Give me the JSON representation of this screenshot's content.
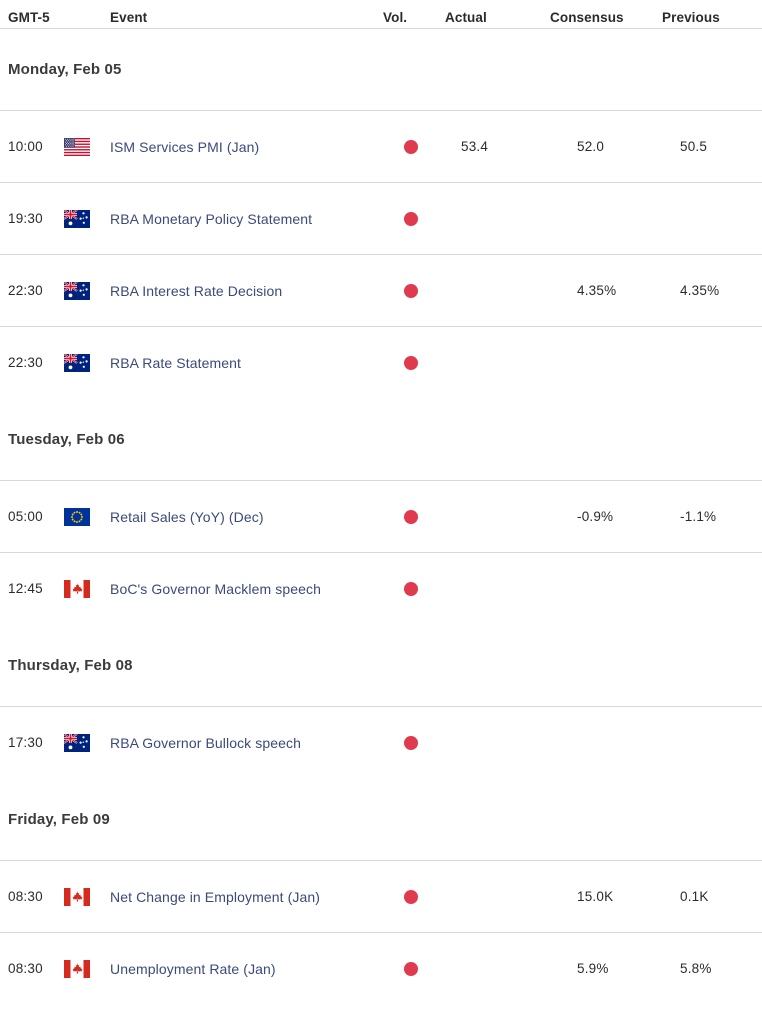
{
  "columns": {
    "time": "GMT-5",
    "event": "Event",
    "vol": "Vol.",
    "actual": "Actual",
    "consensus": "Consensus",
    "previous": "Previous"
  },
  "colors": {
    "volatility_dot": "#e03a4e",
    "event_link": "#3b4a7a",
    "divider": "#d6d9dc",
    "text": "#2b2b2b"
  },
  "groups": [
    {
      "date": "Monday, Feb 05",
      "rows": [
        {
          "time": "10:00",
          "flag": "us-flag-icon",
          "event": "ISM Services PMI (Jan)",
          "vol": "high-volatility-dot",
          "actual": "53.4",
          "consensus": "52.0",
          "previous": "50.5"
        },
        {
          "time": "19:30",
          "flag": "au-flag-icon",
          "event": "RBA Monetary Policy Statement",
          "vol": "high-volatility-dot",
          "actual": "",
          "consensus": "",
          "previous": ""
        },
        {
          "time": "22:30",
          "flag": "au-flag-icon",
          "event": "RBA Interest Rate Decision",
          "vol": "high-volatility-dot",
          "actual": "",
          "consensus": "4.35%",
          "previous": "4.35%"
        },
        {
          "time": "22:30",
          "flag": "au-flag-icon",
          "event": "RBA Rate Statement",
          "vol": "high-volatility-dot",
          "actual": "",
          "consensus": "",
          "previous": ""
        }
      ]
    },
    {
      "date": "Tuesday, Feb 06",
      "rows": [
        {
          "time": "05:00",
          "flag": "eu-flag-icon",
          "event": "Retail Sales (YoY) (Dec)",
          "vol": "high-volatility-dot",
          "actual": "",
          "consensus": "-0.9%",
          "previous": "-1.1%"
        },
        {
          "time": "12:45",
          "flag": "ca-flag-icon",
          "event": "BoC's Governor Macklem speech",
          "vol": "high-volatility-dot",
          "actual": "",
          "consensus": "",
          "previous": ""
        }
      ]
    },
    {
      "date": "Thursday, Feb 08",
      "rows": [
        {
          "time": "17:30",
          "flag": "au-flag-icon",
          "event": "RBA Governor Bullock speech",
          "vol": "high-volatility-dot",
          "actual": "",
          "consensus": "",
          "previous": ""
        }
      ]
    },
    {
      "date": "Friday, Feb 09",
      "rows": [
        {
          "time": "08:30",
          "flag": "ca-flag-icon",
          "event": "Net Change in Employment (Jan)",
          "vol": "high-volatility-dot",
          "actual": "",
          "consensus": "15.0K",
          "previous": "0.1K"
        },
        {
          "time": "08:30",
          "flag": "ca-flag-icon",
          "event": "Unemployment Rate (Jan)",
          "vol": "high-volatility-dot",
          "actual": "",
          "consensus": "5.9%",
          "previous": "5.8%"
        }
      ]
    }
  ]
}
